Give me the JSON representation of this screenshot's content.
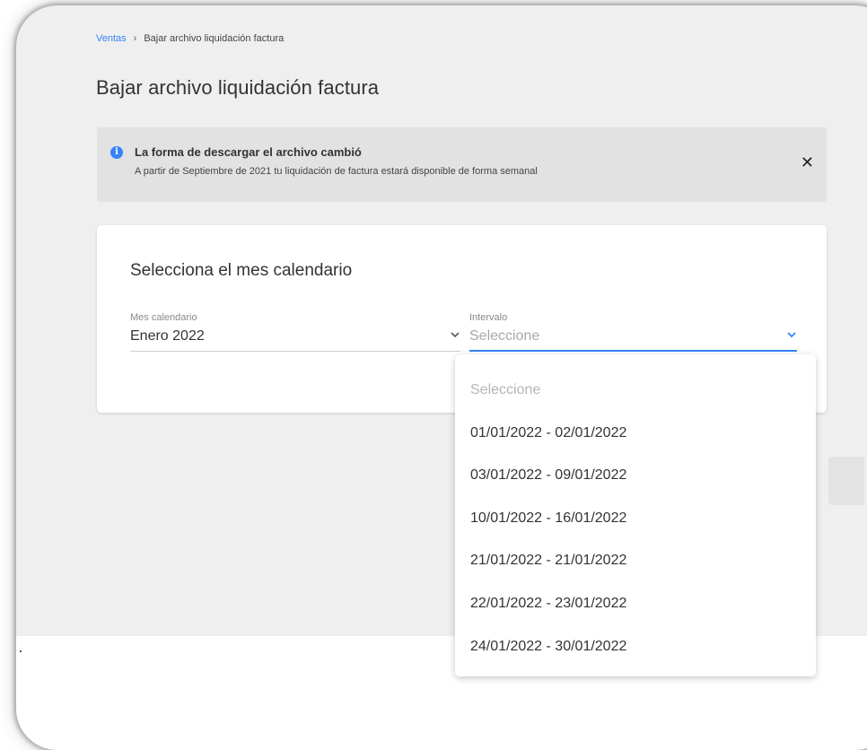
{
  "breadcrumb": {
    "root": "Ventas",
    "separator": "›",
    "current": "Bajar archivo liquidación factura"
  },
  "page": {
    "title": "Bajar archivo liquidación factura"
  },
  "banner": {
    "icon": "info-icon",
    "title": "La forma de descargar el archivo cambió",
    "text": "A partir de Septiembre de 2021 tu liquidación de factura estará disponible de forma semanal",
    "close": "✕"
  },
  "card": {
    "title": "Selecciona el mes calendario",
    "month_field": {
      "label": "Mes calendario",
      "value": "Enero 2022"
    },
    "interval_field": {
      "label": "Intervalo",
      "placeholder": "Seleccione"
    }
  },
  "dropdown": {
    "placeholder": "Seleccione",
    "options": [
      "01/01/2022 - 02/01/2022",
      "03/01/2022 - 09/01/2022",
      "10/01/2022 - 16/01/2022",
      "21/01/2022 - 21/01/2022",
      "22/01/2022 - 23/01/2022",
      "24/01/2022 - 30/01/2022"
    ]
  },
  "colors": {
    "accent": "#3483fa",
    "background": "#efefef",
    "banner": "#e2e2e2"
  }
}
